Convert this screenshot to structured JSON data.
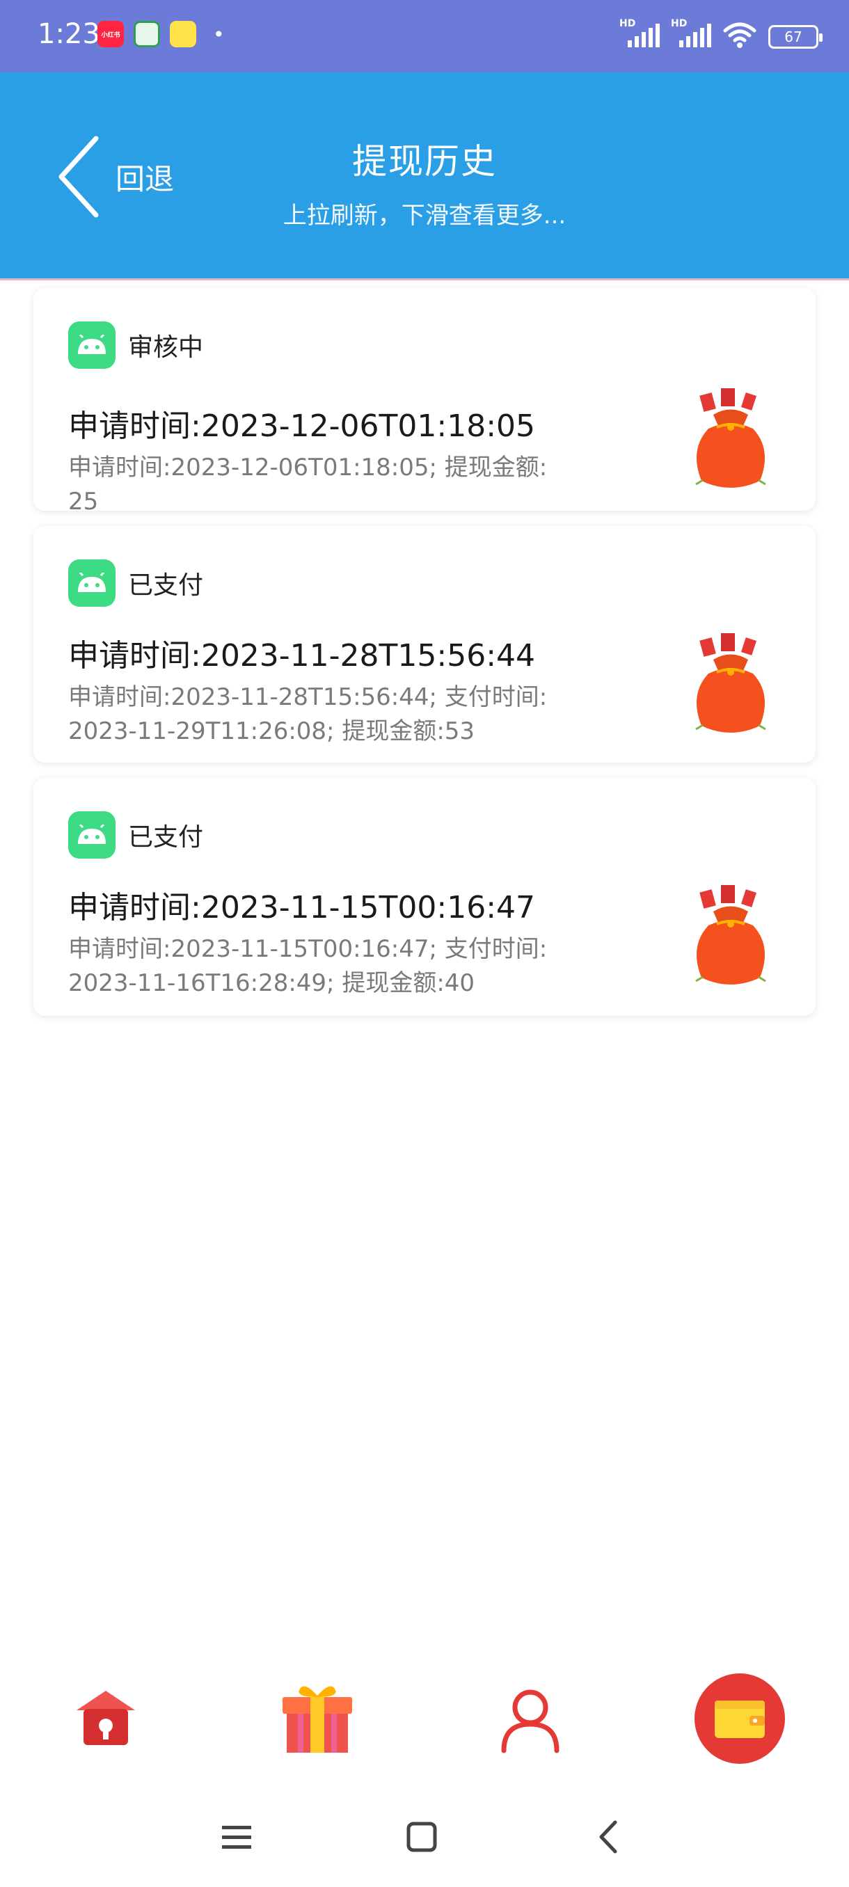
{
  "status_bar": {
    "time": "1:23",
    "app_icons": [
      "xiaohongshu-icon",
      "app-green-icon",
      "app-yellow-icon"
    ],
    "xiaohongshu_label": "小红书",
    "hd1": "HD",
    "hd2": "HD",
    "battery": "67"
  },
  "header": {
    "back_label": "回退",
    "title": "提现历史",
    "subtitle": "上拉刷新，下滑查看更多..."
  },
  "records": [
    {
      "status": "审核中",
      "title": "申请时间:2023-12-06T01:18:05",
      "detail": "申请时间:2023-12-06T01:18:05; 提现金额:25"
    },
    {
      "status": "已支付",
      "title": "申请时间:2023-11-28T15:56:44",
      "detail": "申请时间:2023-11-28T15:56:44; 支付时间:2023-11-29T11:26:08; 提现金额:53"
    },
    {
      "status": "已支付",
      "title": "申请时间:2023-11-15T00:16:47",
      "detail": "申请时间:2023-11-15T00:16:47; 支付时间:2023-11-16T16:28:49; 提现金额:40"
    }
  ],
  "bottom_nav": [
    "home-icon",
    "gift-icon",
    "profile-icon",
    "wallet-icon"
  ],
  "system_nav": [
    "menu-icon",
    "home-square-icon",
    "back-chevron-icon"
  ],
  "colors": {
    "status_bar": "#6c7bd8",
    "header": "#2a9fe6",
    "android_green": "#3ddc84",
    "accent_red": "#e53935"
  }
}
